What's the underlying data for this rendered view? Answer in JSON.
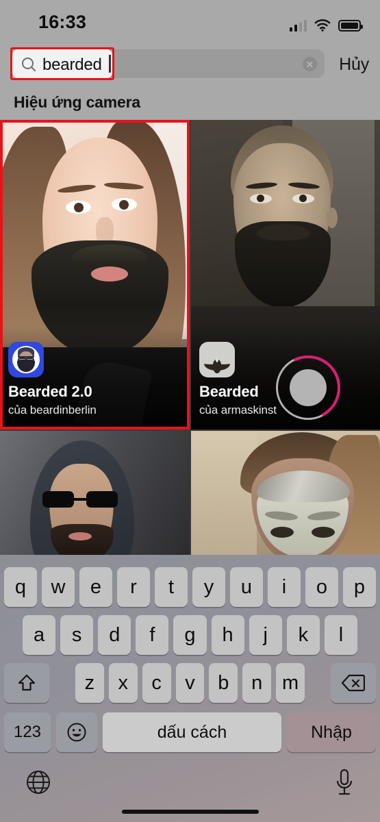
{
  "status_bar": {
    "time": "16:33",
    "signal_icon": "cellular-signal-icon",
    "signal_bars_filled": 2,
    "signal_bars_total": 4,
    "wifi_icon": "wifi-icon",
    "battery_icon": "battery-icon",
    "battery_level_percent": 100
  },
  "search": {
    "query": "bearded",
    "placeholder": "",
    "search_icon": "search-icon",
    "clear_icon": "clear-icon",
    "cancel_label": "Hủy",
    "highlight_color": "#e8131a"
  },
  "section": {
    "header": "Hiệu ứng camera"
  },
  "effects": [
    {
      "name": "Bearded 2.0",
      "author": "của beardinberlin",
      "icon": "bearded-2-app-icon",
      "icon_color": "#2f49e0",
      "selected": true
    },
    {
      "name": "Bearded",
      "author": "của armaskinst",
      "icon": "bearded-app-icon",
      "icon_color": "#cfcfcb",
      "selected": false
    },
    {
      "name": "",
      "author": "",
      "icon": "",
      "icon_color": "",
      "selected": false
    },
    {
      "name": "",
      "author": "",
      "icon": "",
      "icon_color": "",
      "selected": false
    }
  ],
  "camera": {
    "shutter_icon": "shutter-button",
    "progress_color": "#d91e74"
  },
  "keyboard": {
    "row1": [
      "q",
      "w",
      "e",
      "r",
      "t",
      "y",
      "u",
      "i",
      "o",
      "p"
    ],
    "row2": [
      "a",
      "s",
      "d",
      "f",
      "g",
      "h",
      "j",
      "k",
      "l"
    ],
    "row3": [
      "z",
      "x",
      "c",
      "v",
      "b",
      "n",
      "m"
    ],
    "shift_icon": "shift-icon",
    "backspace_icon": "backspace-icon",
    "numbers_label": "123",
    "emoji_icon": "emoji-icon",
    "space_label": "dấu cách",
    "enter_label": "Nhập",
    "globe_icon": "globe-icon",
    "microphone_icon": "microphone-icon"
  }
}
